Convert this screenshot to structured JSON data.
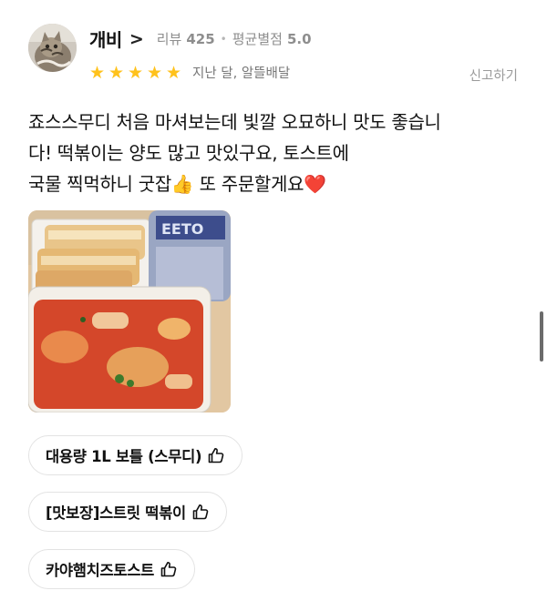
{
  "reviewer": {
    "nickname": "개비",
    "chevron": ">",
    "review_count_label": "리뷰",
    "review_count": "425",
    "separator": "•",
    "avg_rating_label": "평균별점",
    "avg_rating": "5.0"
  },
  "rating": {
    "stars": 5,
    "max_stars": 5
  },
  "meta": "지난 달, 알뜰배달",
  "report_label": "신고하기",
  "review_lines": [
    "죠스스무디 처음 마셔보는데 빛깔 오묘하니 맛도 좋습니",
    "다! 떡볶이는 양도 많고 맛있구요, 토스트에",
    "국물 찍먹하니 굿잡👍 또 주문할게요❤️"
  ],
  "menu_items": [
    {
      "label": "대용량 1L 보틀 (스무디)",
      "icon": "thumbs-up-outline-icon"
    },
    {
      "label": "[맛보장]스트릿 떡볶이",
      "icon": "thumbs-up-outline-icon"
    },
    {
      "label": "카야햄치즈토스트",
      "icon": "thumbs-up-outline-icon"
    }
  ],
  "colors": {
    "star": "#ffc21c",
    "muted": "#8e8e8e",
    "chip_border": "#e3e3e3"
  }
}
